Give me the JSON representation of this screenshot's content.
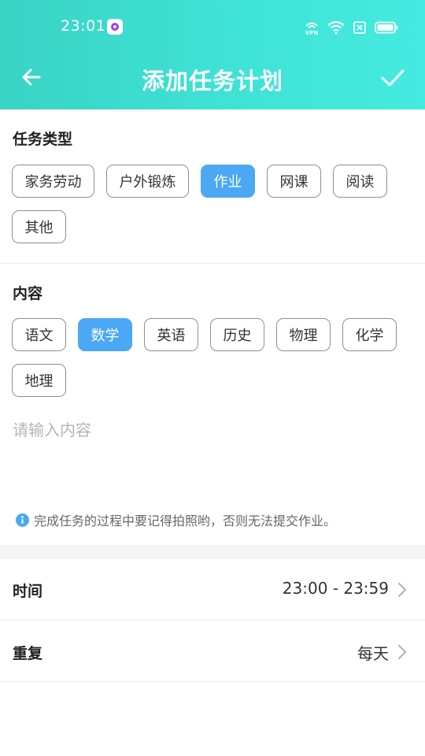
{
  "status_bar": {
    "time": "23:01",
    "icons": [
      "vpn-icon",
      "wifi-icon",
      "sim-off-icon",
      "battery-icon"
    ]
  },
  "nav": {
    "title": "添加任务计划",
    "back_icon": "arrow-left-icon",
    "confirm_icon": "check-icon"
  },
  "task_type": {
    "title": "任务类型",
    "options": [
      "家务劳动",
      "户外锻炼",
      "作业",
      "网课",
      "阅读",
      "其他"
    ],
    "selected": "作业"
  },
  "content": {
    "title": "内容",
    "options": [
      "语文",
      "数学",
      "英语",
      "历史",
      "物理",
      "化学",
      "地理"
    ],
    "selected": "数学",
    "input_value": "",
    "input_placeholder": "请输入内容"
  },
  "tip": {
    "icon": "info-icon",
    "text": "完成任务的过程中要记得拍照哟，否则无法提交作业。"
  },
  "settings": {
    "time_label": "时间",
    "time_value": "23:00 - 23:59",
    "repeat_label": "重复",
    "repeat_value": "每天"
  },
  "colors": {
    "header_gradient_start": "#39d3c4",
    "header_gradient_end": "#45ebe0",
    "chip_active": "#4aa8f5",
    "chip_border": "#8f8f8f"
  }
}
